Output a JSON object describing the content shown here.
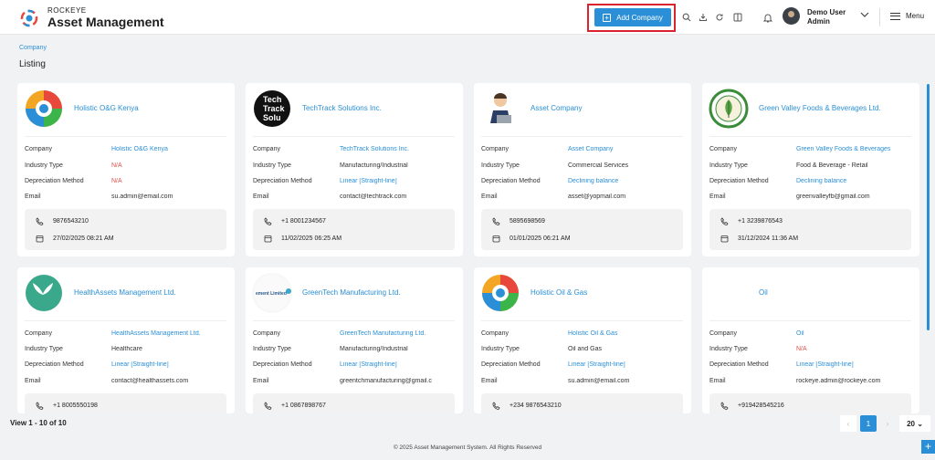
{
  "brand": {
    "top": "ROCKEYE",
    "main": "Asset Management"
  },
  "header": {
    "add_label": "Add Company",
    "user_name": "Demo User",
    "user_role": "Admin",
    "menu_label": "Menu"
  },
  "breadcrumb": "Company",
  "page_title": "Listing",
  "labels": {
    "company": "Company",
    "industry": "Industry Type",
    "depreciation": "Depreciation Method",
    "email": "Email"
  },
  "cards": [
    {
      "title": "Holistic O&G Kenya",
      "company": "Holistic O&G Kenya",
      "industry": "N/A",
      "depreciation": "N/A",
      "email": "su.admin@email.com",
      "phone": "9876543210",
      "date": "27/02/2025 08:21 AM"
    },
    {
      "title": "TechTrack Solutions Inc.",
      "company": "TechTrack Solutions Inc.",
      "industry": "Manufacturing/Industrial",
      "depreciation": "Linear [Straight-line]",
      "email": "contact@techtrack.com",
      "phone": "+1 8001234567",
      "date": "11/02/2025 06:25 AM"
    },
    {
      "title": "Asset Company",
      "company": "Asset Company",
      "industry": "Commercial Services",
      "depreciation": "Declining balance",
      "email": "asset@yopmail.com",
      "phone": "5895698569",
      "date": "01/01/2025 06:21 AM"
    },
    {
      "title": "Green Valley Foods & Beverages Ltd.",
      "company": "Green Valley Foods & Beverages",
      "industry": "Food & Beverage - Retail",
      "depreciation": "Declining balance",
      "email": "greenvalleyfb@gmail.com",
      "phone": "+1 3239876543",
      "date": "31/12/2024 11:36 AM"
    },
    {
      "title": "HealthAssets Management Ltd.",
      "company": "HealthAssets Management Ltd.",
      "industry": "Healthcare",
      "depreciation": "Linear [Straight-line]",
      "email": "contact@healthassets.com",
      "phone": "+1 8005550198"
    },
    {
      "title": "GreenTech Manufacturing Ltd.",
      "company": "GreenTech Manufacturing Ltd.",
      "industry": "Manufacturing/Industrial",
      "depreciation": "Linear [Straight-line]",
      "email": "greentchmanufacturing@gmail.c",
      "phone": "+1 0867898767"
    },
    {
      "title": "Holistic Oil & Gas",
      "company": "Holistic Oil & Gas",
      "industry": "Oil and Gas",
      "depreciation": "Linear [Straight-line]",
      "email": "su.admin@email.com",
      "phone": "+234 9876543210"
    },
    {
      "title": "Oil",
      "company": "Oil",
      "industry": "N/A",
      "depreciation": "Linear [Straight-line]",
      "email": "rockeye.admin@rockeye.com",
      "phone": "+919428545216"
    }
  ],
  "logo_text": {
    "techtrack": "Tech Track Solu",
    "greentech": "ement Limited"
  },
  "pagination": {
    "view": "View 1 - 10 of 10",
    "prev": "‹",
    "current": "1",
    "next": "›",
    "page_size": "20 ⌄"
  },
  "footer": "© 2025 Asset Management System. All Rights Reserved",
  "fab": "+",
  "colors": {
    "accent": "#2a8fd6",
    "na": "#e0524a",
    "highlight": "#d9232d"
  }
}
